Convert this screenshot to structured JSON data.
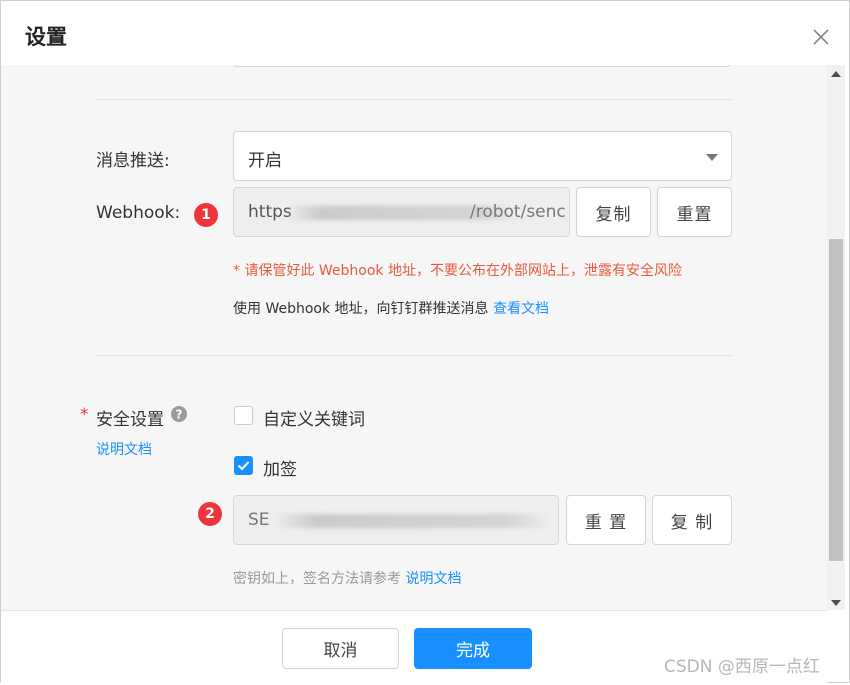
{
  "dialog": {
    "title": "设置"
  },
  "push": {
    "label": "消息推送:",
    "value": "开启"
  },
  "webhook": {
    "label": "Webhook:",
    "badge": "1",
    "url_prefix": "https",
    "url_mid": "/robot/senc",
    "copy_label": "复制",
    "reset_label": "重置",
    "warning": "* 请保管好此 Webhook 地址，不要公布在外部网站上，泄露有安全风险",
    "usage_text": "使用 Webhook 地址，向钉钉群推送消息",
    "usage_link": "查看文档"
  },
  "security": {
    "required_mark": "*",
    "label": "安全设置",
    "doc_link": "说明文档",
    "custom_keyword": {
      "label": "自定义关键词",
      "checked": false
    },
    "sign": {
      "label": "加签",
      "checked": true
    },
    "badge": "2",
    "secret_prefix": "SE",
    "secret_suffix": "",
    "reset_label": "重 置",
    "copy_label": "复 制",
    "note_text": "密钥如上，签名方法请参考",
    "note_link": "说明文档"
  },
  "footer": {
    "cancel_label": "取消",
    "done_label": "完成"
  },
  "watermark": "CSDN @西原一点红",
  "colors": {
    "primary": "#1890ff",
    "danger": "#f0343c",
    "warning_text": "#e85a3d"
  }
}
